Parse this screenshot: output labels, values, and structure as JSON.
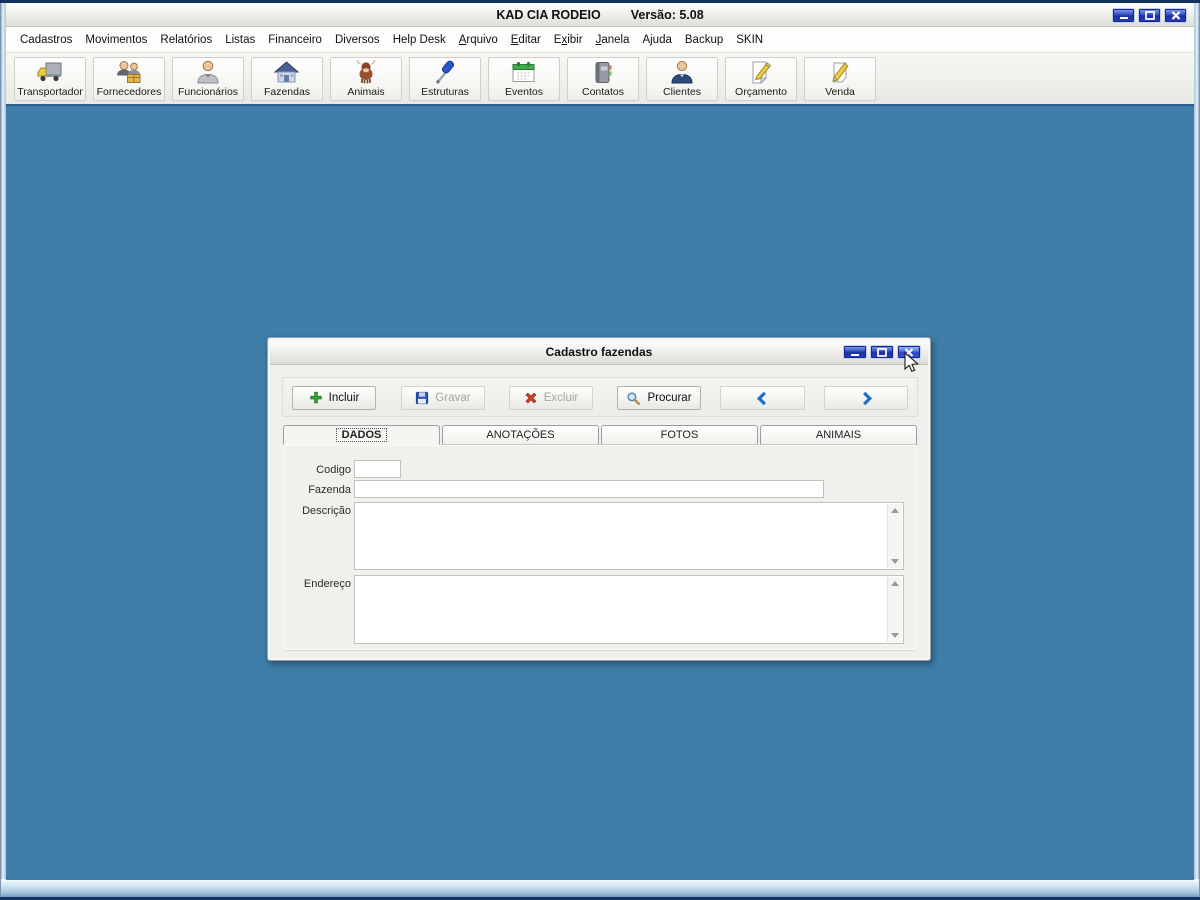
{
  "window": {
    "title": "KAD CIA RODEIO",
    "version": "Versão: 5.08"
  },
  "menu": {
    "items": [
      {
        "label": "Cadastros"
      },
      {
        "label": "Movimentos"
      },
      {
        "label": "Relatórios"
      },
      {
        "label": "Listas"
      },
      {
        "label": "Financeiro"
      },
      {
        "label": "Diversos"
      },
      {
        "label": "Help Desk"
      },
      {
        "pre": "",
        "u": "A",
        "post": "rquivo"
      },
      {
        "pre": "",
        "u": "E",
        "post": "ditar"
      },
      {
        "pre": "E",
        "u": "x",
        "post": "ibir"
      },
      {
        "pre": "",
        "u": "J",
        "post": "anela"
      },
      {
        "label": "Ajuda"
      },
      {
        "label": "Backup"
      },
      {
        "label": "SKIN"
      }
    ]
  },
  "toolbar": {
    "buttons": [
      {
        "label": "Transportador",
        "icon": "truck-icon"
      },
      {
        "label": "Fornecedores",
        "icon": "suppliers-icon"
      },
      {
        "label": "Funcionários",
        "icon": "employee-icon"
      },
      {
        "label": "Fazendas",
        "icon": "farm-house-icon"
      },
      {
        "label": "Animais",
        "icon": "cow-icon"
      },
      {
        "label": "Estruturas",
        "icon": "screwdriver-icon"
      },
      {
        "label": "Eventos",
        "icon": "calendar-icon"
      },
      {
        "label": "Contatos",
        "icon": "address-book-icon"
      },
      {
        "label": "Clientes",
        "icon": "client-person-icon"
      },
      {
        "label": "Orçamento",
        "icon": "budget-pencil-icon"
      },
      {
        "label": "Venda",
        "icon": "sale-pencil-icon"
      }
    ]
  },
  "dialog": {
    "title": "Cadastro fazendas",
    "buttons": [
      {
        "label": "Incluir",
        "icon": "add-icon",
        "enabled": true
      },
      {
        "label": "Gravar",
        "icon": "save-icon",
        "enabled": false
      },
      {
        "label": "Excluir",
        "icon": "delete-icon",
        "enabled": false
      },
      {
        "label": "Procurar",
        "icon": "search-icon",
        "enabled": true
      },
      {
        "label": "",
        "icon": "arrow-left-icon",
        "enabled": true
      },
      {
        "label": "",
        "icon": "arrow-right-icon",
        "enabled": true
      }
    ],
    "tabs": [
      {
        "label": "DADOS",
        "active": true
      },
      {
        "label": "ANOTAÇÕES",
        "active": false
      },
      {
        "label": "FOTOS",
        "active": false
      },
      {
        "label": "ANIMAIS",
        "active": false
      }
    ],
    "form": {
      "fields": [
        {
          "label": "Codigo",
          "value": ""
        },
        {
          "label": "Fazenda",
          "value": ""
        },
        {
          "label": "Descrição",
          "value": ""
        },
        {
          "label": "Endereço",
          "value": ""
        }
      ]
    }
  },
  "colors": {
    "client-bg": "#3e7ea8",
    "frame-navy": "#14305c",
    "control-blue": "#2340b2",
    "add-green": "#35a535",
    "delete-red": "#d8402c",
    "chevron-blue": "#1d6fce"
  }
}
